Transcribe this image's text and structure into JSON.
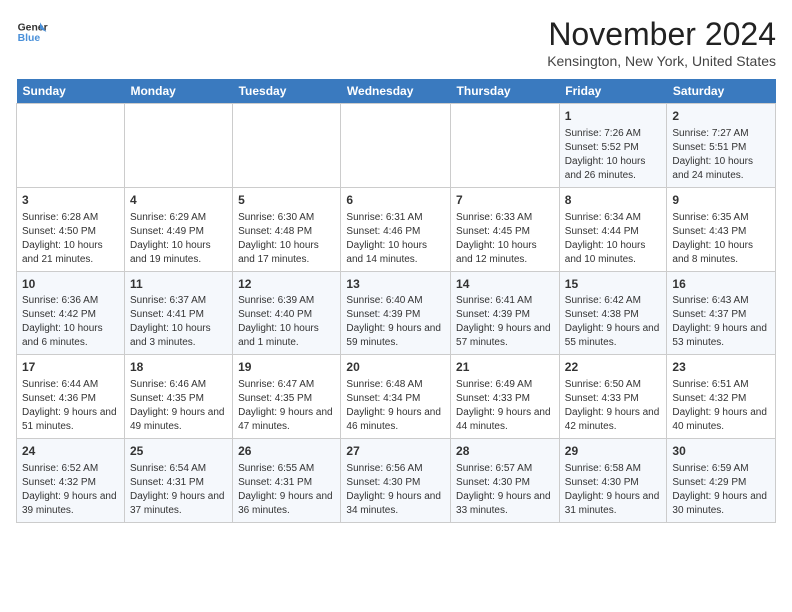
{
  "header": {
    "logo_line1": "General",
    "logo_line2": "Blue",
    "title": "November 2024",
    "subtitle": "Kensington, New York, United States"
  },
  "weekdays": [
    "Sunday",
    "Monday",
    "Tuesday",
    "Wednesday",
    "Thursday",
    "Friday",
    "Saturday"
  ],
  "weeks": [
    [
      {
        "day": "",
        "info": ""
      },
      {
        "day": "",
        "info": ""
      },
      {
        "day": "",
        "info": ""
      },
      {
        "day": "",
        "info": ""
      },
      {
        "day": "",
        "info": ""
      },
      {
        "day": "1",
        "info": "Sunrise: 7:26 AM\nSunset: 5:52 PM\nDaylight: 10 hours and 26 minutes."
      },
      {
        "day": "2",
        "info": "Sunrise: 7:27 AM\nSunset: 5:51 PM\nDaylight: 10 hours and 24 minutes."
      }
    ],
    [
      {
        "day": "3",
        "info": "Sunrise: 6:28 AM\nSunset: 4:50 PM\nDaylight: 10 hours and 21 minutes."
      },
      {
        "day": "4",
        "info": "Sunrise: 6:29 AM\nSunset: 4:49 PM\nDaylight: 10 hours and 19 minutes."
      },
      {
        "day": "5",
        "info": "Sunrise: 6:30 AM\nSunset: 4:48 PM\nDaylight: 10 hours and 17 minutes."
      },
      {
        "day": "6",
        "info": "Sunrise: 6:31 AM\nSunset: 4:46 PM\nDaylight: 10 hours and 14 minutes."
      },
      {
        "day": "7",
        "info": "Sunrise: 6:33 AM\nSunset: 4:45 PM\nDaylight: 10 hours and 12 minutes."
      },
      {
        "day": "8",
        "info": "Sunrise: 6:34 AM\nSunset: 4:44 PM\nDaylight: 10 hours and 10 minutes."
      },
      {
        "day": "9",
        "info": "Sunrise: 6:35 AM\nSunset: 4:43 PM\nDaylight: 10 hours and 8 minutes."
      }
    ],
    [
      {
        "day": "10",
        "info": "Sunrise: 6:36 AM\nSunset: 4:42 PM\nDaylight: 10 hours and 6 minutes."
      },
      {
        "day": "11",
        "info": "Sunrise: 6:37 AM\nSunset: 4:41 PM\nDaylight: 10 hours and 3 minutes."
      },
      {
        "day": "12",
        "info": "Sunrise: 6:39 AM\nSunset: 4:40 PM\nDaylight: 10 hours and 1 minute."
      },
      {
        "day": "13",
        "info": "Sunrise: 6:40 AM\nSunset: 4:39 PM\nDaylight: 9 hours and 59 minutes."
      },
      {
        "day": "14",
        "info": "Sunrise: 6:41 AM\nSunset: 4:39 PM\nDaylight: 9 hours and 57 minutes."
      },
      {
        "day": "15",
        "info": "Sunrise: 6:42 AM\nSunset: 4:38 PM\nDaylight: 9 hours and 55 minutes."
      },
      {
        "day": "16",
        "info": "Sunrise: 6:43 AM\nSunset: 4:37 PM\nDaylight: 9 hours and 53 minutes."
      }
    ],
    [
      {
        "day": "17",
        "info": "Sunrise: 6:44 AM\nSunset: 4:36 PM\nDaylight: 9 hours and 51 minutes."
      },
      {
        "day": "18",
        "info": "Sunrise: 6:46 AM\nSunset: 4:35 PM\nDaylight: 9 hours and 49 minutes."
      },
      {
        "day": "19",
        "info": "Sunrise: 6:47 AM\nSunset: 4:35 PM\nDaylight: 9 hours and 47 minutes."
      },
      {
        "day": "20",
        "info": "Sunrise: 6:48 AM\nSunset: 4:34 PM\nDaylight: 9 hours and 46 minutes."
      },
      {
        "day": "21",
        "info": "Sunrise: 6:49 AM\nSunset: 4:33 PM\nDaylight: 9 hours and 44 minutes."
      },
      {
        "day": "22",
        "info": "Sunrise: 6:50 AM\nSunset: 4:33 PM\nDaylight: 9 hours and 42 minutes."
      },
      {
        "day": "23",
        "info": "Sunrise: 6:51 AM\nSunset: 4:32 PM\nDaylight: 9 hours and 40 minutes."
      }
    ],
    [
      {
        "day": "24",
        "info": "Sunrise: 6:52 AM\nSunset: 4:32 PM\nDaylight: 9 hours and 39 minutes."
      },
      {
        "day": "25",
        "info": "Sunrise: 6:54 AM\nSunset: 4:31 PM\nDaylight: 9 hours and 37 minutes."
      },
      {
        "day": "26",
        "info": "Sunrise: 6:55 AM\nSunset: 4:31 PM\nDaylight: 9 hours and 36 minutes."
      },
      {
        "day": "27",
        "info": "Sunrise: 6:56 AM\nSunset: 4:30 PM\nDaylight: 9 hours and 34 minutes."
      },
      {
        "day": "28",
        "info": "Sunrise: 6:57 AM\nSunset: 4:30 PM\nDaylight: 9 hours and 33 minutes."
      },
      {
        "day": "29",
        "info": "Sunrise: 6:58 AM\nSunset: 4:30 PM\nDaylight: 9 hours and 31 minutes."
      },
      {
        "day": "30",
        "info": "Sunrise: 6:59 AM\nSunset: 4:29 PM\nDaylight: 9 hours and 30 minutes."
      }
    ]
  ]
}
